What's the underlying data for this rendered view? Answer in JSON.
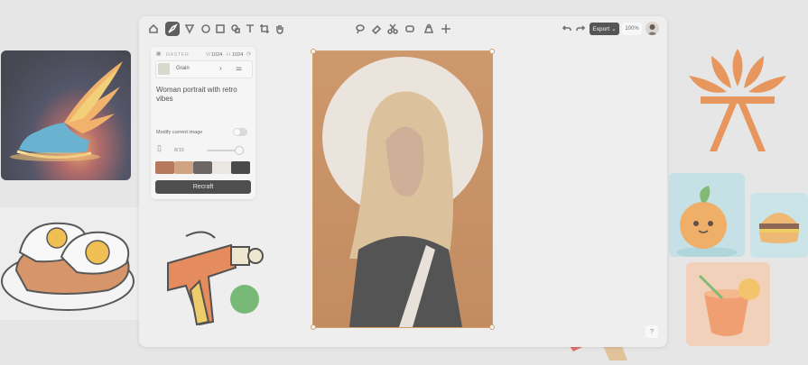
{
  "toolbar": {
    "tools": [
      "home-icon",
      "brush-icon",
      "pen-icon",
      "image-icon",
      "frame-icon",
      "shapes-icon",
      "text-icon",
      "crop-icon",
      "hand-icon"
    ],
    "center_tools": [
      "lasso-icon",
      "eraser-icon",
      "scissors-icon",
      "vectorize-icon",
      "remove-bg-icon",
      "move-icon"
    ],
    "export_label": "Export",
    "zoom_label": "100%"
  },
  "panel": {
    "header_label": "RASTER",
    "width_prefix": "W",
    "width_value": "1024",
    "height_prefix": "H",
    "height_value": "1024",
    "style_name": "Grain",
    "prompt_text": "Woman portrait with retro vibes",
    "modify_label": "Modify current image",
    "count_label": "8/10",
    "palette": [
      "#a6502a",
      "#c8895c",
      "#3d3732",
      "#ece8e1",
      "#0e0e0e"
    ],
    "recraft_label": "Recraft"
  },
  "help_label": "?",
  "colors": {
    "accent": "#1e1e1e",
    "selection": "#c9843c",
    "overlay_bg": "#e6e6e6"
  }
}
